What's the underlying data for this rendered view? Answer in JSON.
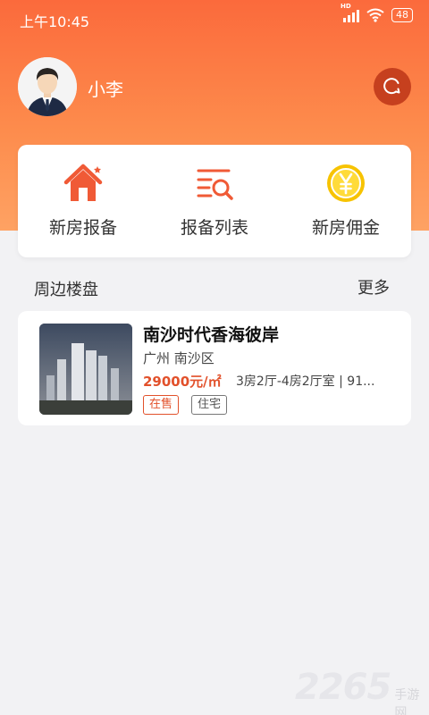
{
  "status_bar": {
    "time": "上午10:45",
    "network": "HD",
    "battery": "48"
  },
  "user": {
    "name": "小李"
  },
  "quick_actions": [
    {
      "label": "新房报备",
      "icon": "house-icon"
    },
    {
      "label": "报备列表",
      "icon": "list-search-icon"
    },
    {
      "label": "新房佣金",
      "icon": "coin-icon"
    }
  ],
  "section": {
    "title": "周边楼盘",
    "more": "更多"
  },
  "listing": {
    "title": "南沙时代香海彼岸",
    "location": "广州 南沙区",
    "price": "29000元/㎡",
    "layout": "3房2厅-4房2厅室 | 91...",
    "tags": [
      "在售",
      "住宅"
    ]
  },
  "watermark": {
    "number": "2265",
    "text": "手游网"
  },
  "colors": {
    "accent": "#fb6a3c",
    "price": "#e2512b",
    "msg_button": "#c6401e",
    "coin": "#f5c400"
  }
}
